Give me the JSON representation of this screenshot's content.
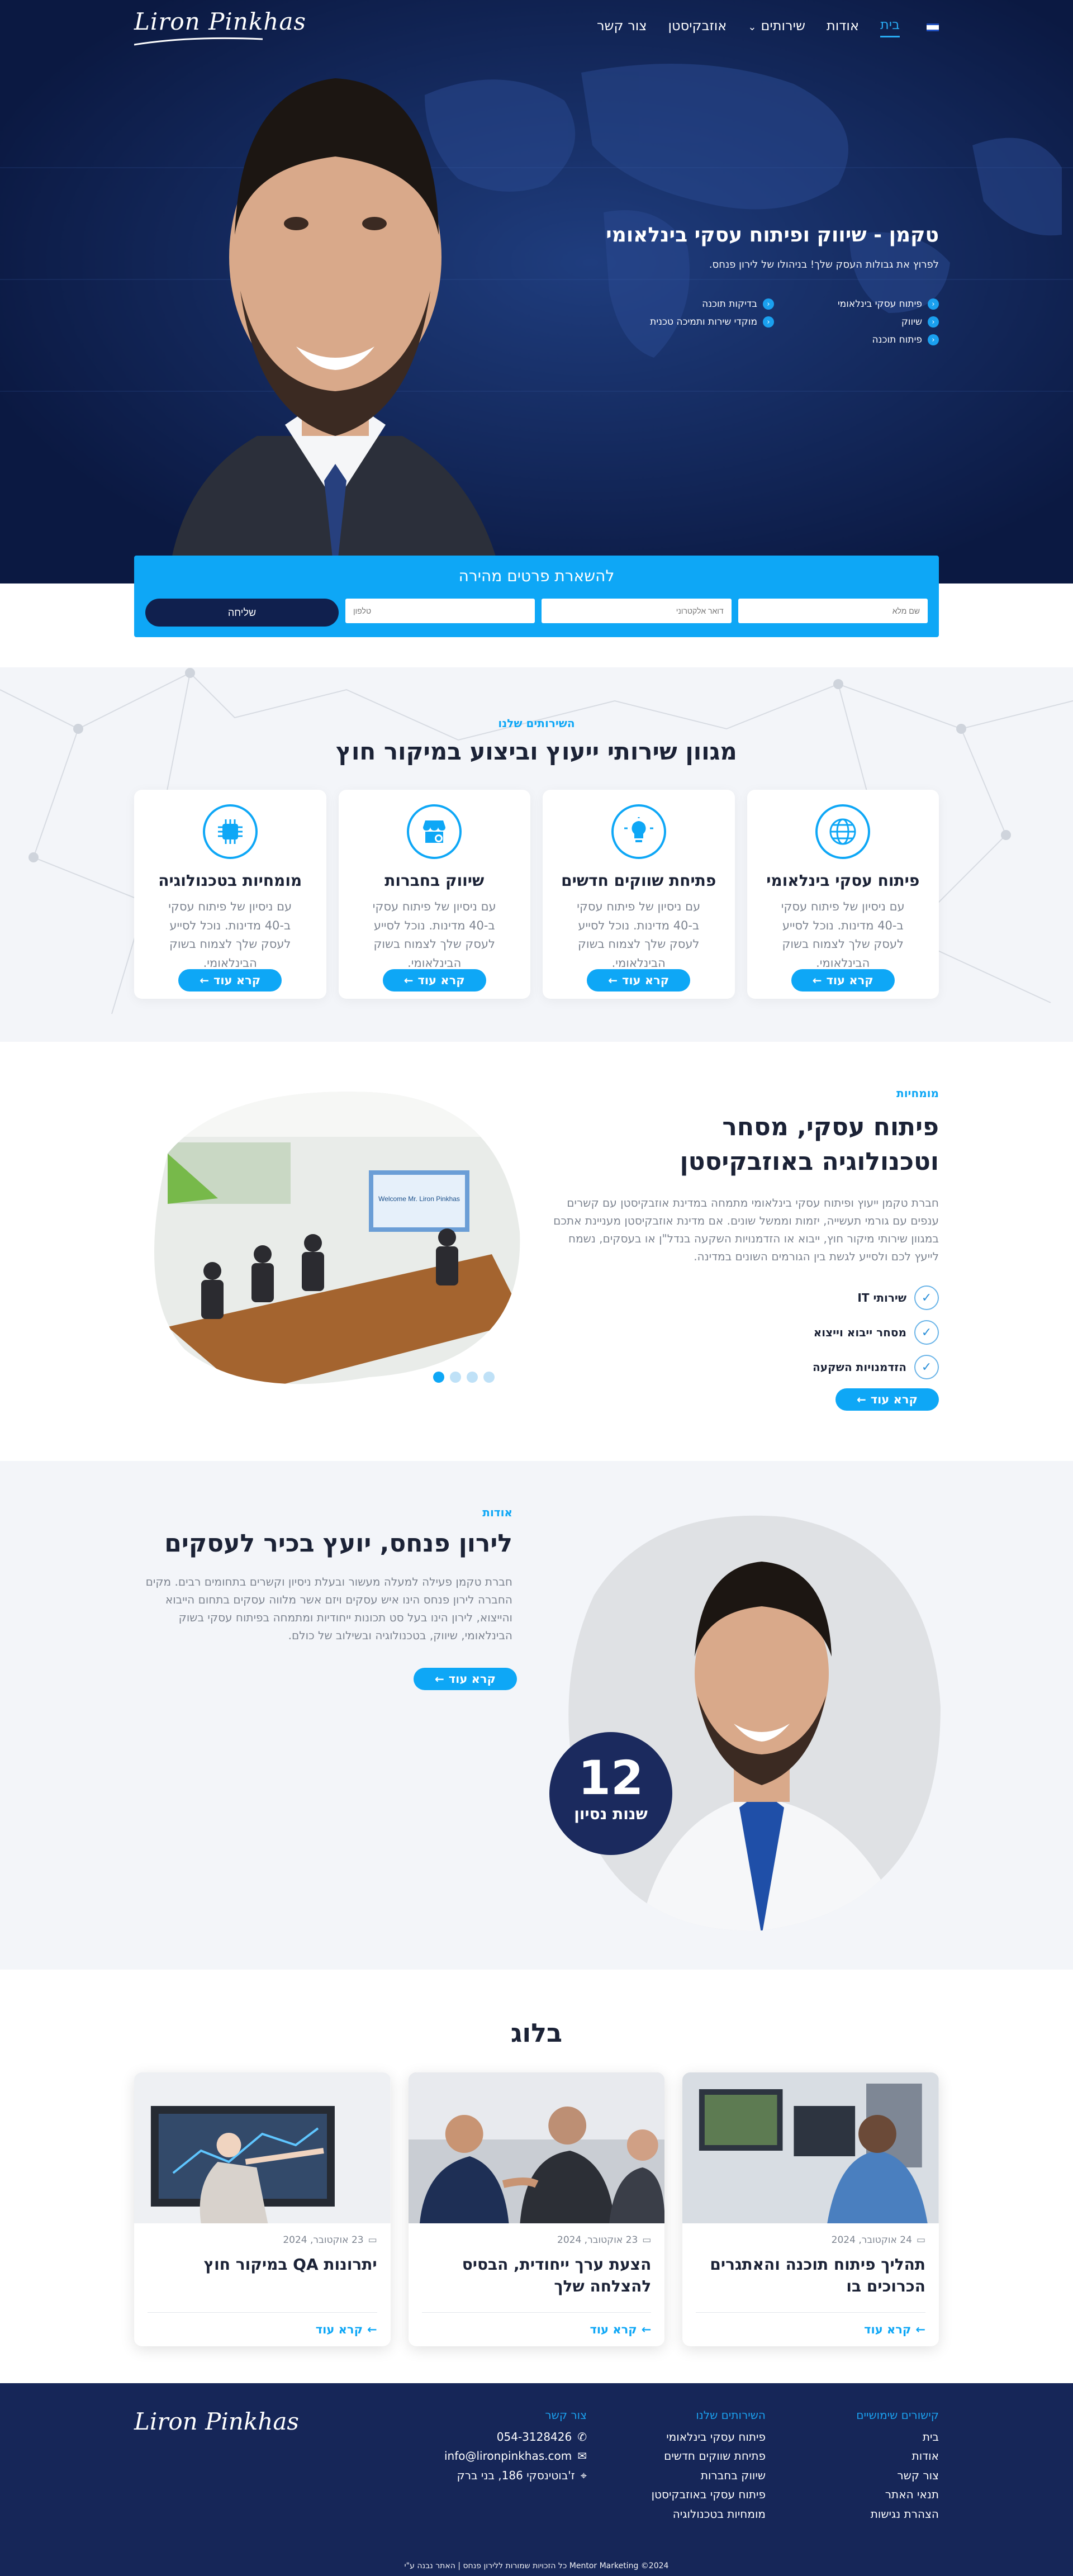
{
  "nav": {
    "logo": "Liron Pinkhas",
    "items": [
      "בית",
      "אודות",
      "שירותים",
      "אוזבקיסטן",
      "צור קשר"
    ]
  },
  "hero": {
    "title": "טקמן - שיווק ופיתוח עסקי בינלאומי",
    "subtitle": "לפרוץ את גבולות העסק שלך! בניהולו של לירון פנחס.",
    "features": [
      "פיתוח עסקי בינלאומי",
      "בדיקות תוכנה",
      "שיווק",
      "מוקדי שירות ותמיכה טכנית",
      "פיתוח תוכנה"
    ]
  },
  "quick_form": {
    "title": "להשארת פרטים מהירה",
    "name_placeholder": "שם מלא",
    "email_placeholder": "דואר אלקטרוני",
    "phone_placeholder": "טלפון",
    "submit": "שליחה"
  },
  "services": {
    "eyebrow": "השירותים שלנו",
    "title": "מגוון שירותי ייעוץ וביצוע במיקור חוץ",
    "cards": [
      {
        "title": "פיתוח עסקי בינלאומי",
        "text": "עם ניסיון של פיתוח עסקי ב-40 מדינות. נוכל לסייע לעסק שלך לצמוח בשוק הבינלאומי.",
        "icon": "globe-icon",
        "cta": "קרא עוד"
      },
      {
        "title": "פתיחת שווקים חדשים",
        "text": "עם ניסיון של פיתוח עסקי ב-40 מדינות. נוכל לסייע לעסק שלך לצמוח בשוק הבינלאומי.",
        "icon": "lightbulb-icon",
        "cta": "קרא עוד"
      },
      {
        "title": "שיווק בחברות",
        "text": "עם ניסיון של פיתוח עסקי ב-40 מדינות. נוכל לסייע לעסק שלך לצמוח בשוק הבינלאומי.",
        "icon": "store-icon",
        "cta": "קרא עוד"
      },
      {
        "title": "מומחיות בטכנולוגיה",
        "text": "עם ניסיון של פיתוח עסקי ב-40 מדינות. נוכל לסייע לעסק שלך לצמוח בשוק הבינלאומי.",
        "icon": "chip-icon",
        "cta": "קרא עוד"
      }
    ]
  },
  "expertise": {
    "eyebrow": "מומחיות",
    "title": "פיתוח עסקי, מסחר וטכנולוגיה באוזבקיסטן",
    "text": "חברת טקמן ייעוץ ופיתוח עסקי בינלאומי מתמחה במדינת אוזבקיסטן עם קשרים ענפים עם גורמי תעשייה, יזמות וממשל שונים. אם מדינת אוזבקיסטן מעניינת אתכם במגוון שירותי מיקור חוץ, ייבוא או הזדמנויות השקעה בנדל\"ן או בעסקים, נשמח לייעץ לכם ולסייע לגשת בין הגורמים השונים במדינה.",
    "checks": [
      "שירותי IT",
      "מסחר ייבוא וייצוא",
      "הזדמנויות השקעה"
    ],
    "cta": "קרא עוד",
    "image_banner": "Welcome Mr. Liron Pinkhas"
  },
  "about": {
    "eyebrow": "אודות",
    "title": "לירון פנחס, יועץ בכיר לעסקים",
    "text": "חברת טקמן פעילה למעלה מעשור ובעלת ניסיון וקשרים בתחומים רבים. מקים החברה לירון פנחס הינו איש עסקים ויזם אשר מלווה עסקים בתחום הייבוא והייצוא, לירון הינו בעל סט תכונות ייחודיות ומתמחה בפיתוח עסקי בשוק הבינלאומי, שיווק, בטכנולוגיה ובשילוב של כולם.",
    "cta": "קרא עוד",
    "years_number": "12",
    "years_label": "שנות נסיון"
  },
  "blog": {
    "title": "בלוג",
    "posts": [
      {
        "date": "24 אוקטובר, 2024",
        "title": "תהליך פיתוח תוכנה והאתגרים הכרוכים בו",
        "cta": "קרא עוד"
      },
      {
        "date": "23 אוקטובר, 2024",
        "title": "הצעת ערך ייחודית, הבסיס להצלחה שלך",
        "cta": "קרא עוד"
      },
      {
        "date": "23 אוקטובר, 2024",
        "title": "יתרונות QA במיקור חוץ",
        "cta": "קרא עוד"
      }
    ]
  },
  "footer": {
    "logo": "Liron Pinkhas",
    "useful_title": "קישורים שימושיים",
    "useful_links": [
      "בית",
      "אודות",
      "צור קשר",
      "תנאי האתר",
      "הצהרת נגישות"
    ],
    "services_title": "השירותים שלנו",
    "services_links": [
      "פיתוח עסקי בינלאומי",
      "פתיחת שווקים חדשים",
      "שיווק בחברות",
      "פיתוח עסקי באוזבקיסטן",
      "מומחיות בטכנולוגיה"
    ],
    "contact_title": "צור קשר",
    "phone": "054-3128426",
    "email": "info@lironpinkhas.com",
    "address": "ז'בוטינסקי 186, בני ברק",
    "copyright": "Mentor Marketing ©2024 כל הזכויות שמורות ללירון פנחס | האתר נבנה ע\"י",
    "colors": {
      "navy": "#162658",
      "accent": "#0ea7f6"
    }
  }
}
